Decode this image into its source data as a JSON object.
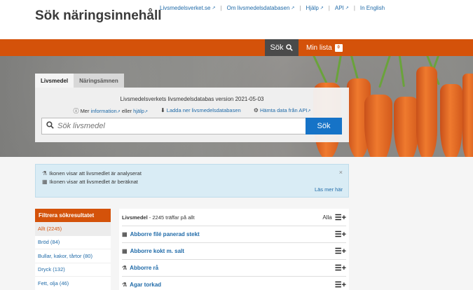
{
  "header": {
    "title": "Sök näringsinnehåll",
    "links": [
      {
        "label": "Livsmedelsverket.se"
      },
      {
        "label": "Om livsmedelsdatabasen"
      },
      {
        "label": "Hjälp"
      },
      {
        "label": "API"
      },
      {
        "label": "In English"
      }
    ]
  },
  "nav": {
    "search_label": "Sök",
    "list_label": "Min lista",
    "list_count": "0"
  },
  "search": {
    "tabs": [
      "Livsmedel",
      "Näringsämnen"
    ],
    "version_text": "Livsmedelsverkets livsmedelsdatabas version 2021-05-03",
    "info_prefix": "Mer",
    "info_link": "information",
    "info_or": "eller",
    "help_link": "hjälp",
    "download_link": "Ladda ner livsmedelsdatabasen",
    "api_link": "Hämta data från API",
    "placeholder": "Sök livsmedel",
    "button": "Sök"
  },
  "info": {
    "line1": "Ikonen visar att livsmedlet är analyserat",
    "line2": "Ikonen visar att livsmedlet är beräknat",
    "more": "Läs mer här",
    "close": "×"
  },
  "filter": {
    "heading": "Filtrera sökresultatet",
    "items": [
      "Allt (2245)",
      "Bröd (84)",
      "Bullar, kakor, tårtor (80)",
      "Dryck (132)",
      "Fett, olja (46)"
    ]
  },
  "results": {
    "category": "Livsmedel",
    "count_text": " - 2245 träffar på allt",
    "all_label": "Alla",
    "rows": [
      {
        "name": "Abborre filé panerad stekt",
        "icon": "calculator-icon"
      },
      {
        "name": "Abborre kokt m. salt",
        "icon": "calculator-icon"
      },
      {
        "name": "Abborre rå",
        "icon": "flask-icon"
      },
      {
        "name": "Agar torkad",
        "icon": "flask-icon"
      }
    ]
  },
  "colors": {
    "accent": "#d4520a",
    "link": "#1f6aa8",
    "button": "#1673c7"
  }
}
